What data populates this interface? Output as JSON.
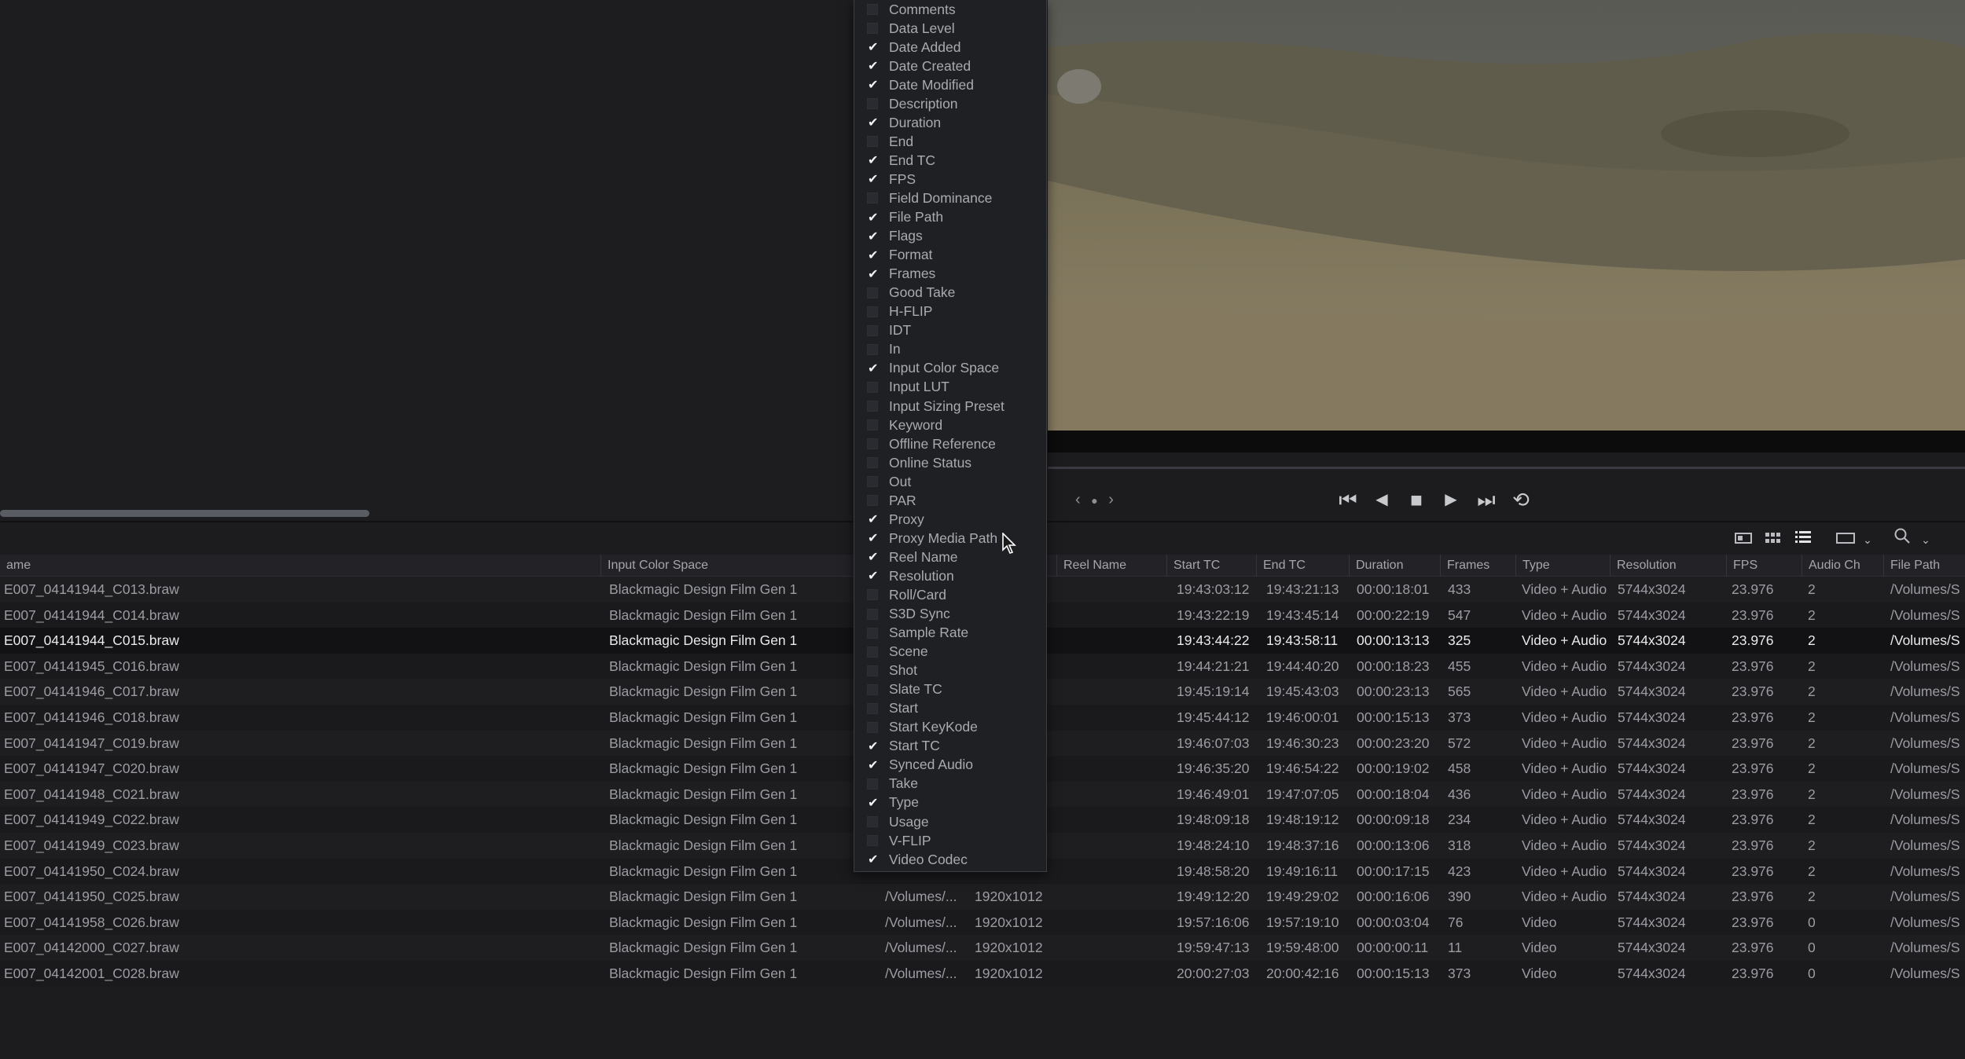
{
  "viewer": {
    "transport": {
      "prev_arrow": "‹",
      "next_arrow": "›",
      "dot": "●",
      "jump_start": "⏮",
      "step_back": "◀",
      "stop": "■",
      "play": "▶",
      "jump_end": "⏭",
      "loop": "⟲"
    }
  },
  "toolbar": {
    "icons": [
      "metadata-view-icon",
      "thumbnail-view-icon",
      "list-view-icon",
      "clip-display-icon",
      "chevron-down-icon",
      "search-icon",
      "chevron-down-icon"
    ]
  },
  "columns_menu": {
    "items": [
      {
        "label": "Comments",
        "checked": false
      },
      {
        "label": "Data Level",
        "checked": false
      },
      {
        "label": "Date Added",
        "checked": true
      },
      {
        "label": "Date Created",
        "checked": true
      },
      {
        "label": "Date Modified",
        "checked": true
      },
      {
        "label": "Description",
        "checked": false
      },
      {
        "label": "Duration",
        "checked": true
      },
      {
        "label": "End",
        "checked": false
      },
      {
        "label": "End TC",
        "checked": true
      },
      {
        "label": "FPS",
        "checked": true
      },
      {
        "label": "Field Dominance",
        "checked": false
      },
      {
        "label": "File Path",
        "checked": true
      },
      {
        "label": "Flags",
        "checked": true
      },
      {
        "label": "Format",
        "checked": true
      },
      {
        "label": "Frames",
        "checked": true
      },
      {
        "label": "Good Take",
        "checked": false
      },
      {
        "label": "H-FLIP",
        "checked": false
      },
      {
        "label": "IDT",
        "checked": false
      },
      {
        "label": "In",
        "checked": false
      },
      {
        "label": "Input Color Space",
        "checked": true
      },
      {
        "label": "Input LUT",
        "checked": false
      },
      {
        "label": "Input Sizing Preset",
        "checked": false
      },
      {
        "label": "Keyword",
        "checked": false
      },
      {
        "label": "Offline Reference",
        "checked": false
      },
      {
        "label": "Online Status",
        "checked": false
      },
      {
        "label": "Out",
        "checked": false
      },
      {
        "label": "PAR",
        "checked": false
      },
      {
        "label": "Proxy",
        "checked": true
      },
      {
        "label": "Proxy Media Path",
        "checked": true
      },
      {
        "label": "Reel Name",
        "checked": true
      },
      {
        "label": "Resolution",
        "checked": true
      },
      {
        "label": "Roll/Card",
        "checked": false
      },
      {
        "label": "S3D Sync",
        "checked": false
      },
      {
        "label": "Sample Rate",
        "checked": false
      },
      {
        "label": "Scene",
        "checked": false
      },
      {
        "label": "Shot",
        "checked": false
      },
      {
        "label": "Slate TC",
        "checked": false
      },
      {
        "label": "Start",
        "checked": false
      },
      {
        "label": "Start KeyKode",
        "checked": false
      },
      {
        "label": "Start TC",
        "checked": true
      },
      {
        "label": "Synced Audio",
        "checked": true
      },
      {
        "label": "Take",
        "checked": false
      },
      {
        "label": "Type",
        "checked": true
      },
      {
        "label": "Usage",
        "checked": false
      },
      {
        "label": "V-FLIP",
        "checked": false
      },
      {
        "label": "Video Codec",
        "checked": true
      }
    ]
  },
  "media_pool": {
    "headers": [
      "ame",
      "Input Color Space",
      "Reel Name",
      "Start TC",
      "End TC",
      "Duration",
      "Frames",
      "Type",
      "Resolution",
      "FPS",
      "Audio Ch",
      "File Path"
    ],
    "rows": [
      {
        "name": "E007_04141944_C013.braw",
        "color_space": "Blackmagic Design Film Gen 1",
        "proxy_path": "",
        "proxy_res": "",
        "start_tc": "19:43:03:12",
        "end_tc": "19:43:21:13",
        "duration": "00:00:18:01",
        "frames": "433",
        "type": "Video + Audio",
        "resolution": "5744x3024",
        "fps": "23.976",
        "audio_ch": "2",
        "file_path": "/Volumes/S"
      },
      {
        "name": "E007_04141944_C014.braw",
        "color_space": "Blackmagic Design Film Gen 1",
        "proxy_path": "",
        "proxy_res": "",
        "start_tc": "19:43:22:19",
        "end_tc": "19:43:45:14",
        "duration": "00:00:22:19",
        "frames": "547",
        "type": "Video + Audio",
        "resolution": "5744x3024",
        "fps": "23.976",
        "audio_ch": "2",
        "file_path": "/Volumes/S"
      },
      {
        "name": "E007_04141944_C015.braw",
        "color_space": "Blackmagic Design Film Gen 1",
        "proxy_path": "",
        "proxy_res": "",
        "start_tc": "19:43:44:22",
        "end_tc": "19:43:58:11",
        "duration": "00:00:13:13",
        "frames": "325",
        "type": "Video + Audio",
        "resolution": "5744x3024",
        "fps": "23.976",
        "audio_ch": "2",
        "file_path": "/Volumes/S",
        "selected": true
      },
      {
        "name": "E007_04141945_C016.braw",
        "color_space": "Blackmagic Design Film Gen 1",
        "proxy_path": "",
        "proxy_res": "",
        "start_tc": "19:44:21:21",
        "end_tc": "19:44:40:20",
        "duration": "00:00:18:23",
        "frames": "455",
        "type": "Video + Audio",
        "resolution": "5744x3024",
        "fps": "23.976",
        "audio_ch": "2",
        "file_path": "/Volumes/S"
      },
      {
        "name": "E007_04141946_C017.braw",
        "color_space": "Blackmagic Design Film Gen 1",
        "proxy_path": "",
        "proxy_res": "",
        "start_tc": "19:45:19:14",
        "end_tc": "19:45:43:03",
        "duration": "00:00:23:13",
        "frames": "565",
        "type": "Video + Audio",
        "resolution": "5744x3024",
        "fps": "23.976",
        "audio_ch": "2",
        "file_path": "/Volumes/S"
      },
      {
        "name": "E007_04141946_C018.braw",
        "color_space": "Blackmagic Design Film Gen 1",
        "proxy_path": "",
        "proxy_res": "",
        "start_tc": "19:45:44:12",
        "end_tc": "19:46:00:01",
        "duration": "00:00:15:13",
        "frames": "373",
        "type": "Video + Audio",
        "resolution": "5744x3024",
        "fps": "23.976",
        "audio_ch": "2",
        "file_path": "/Volumes/S"
      },
      {
        "name": "E007_04141947_C019.braw",
        "color_space": "Blackmagic Design Film Gen 1",
        "proxy_path": "",
        "proxy_res": "",
        "start_tc": "19:46:07:03",
        "end_tc": "19:46:30:23",
        "duration": "00:00:23:20",
        "frames": "572",
        "type": "Video + Audio",
        "resolution": "5744x3024",
        "fps": "23.976",
        "audio_ch": "2",
        "file_path": "/Volumes/S"
      },
      {
        "name": "E007_04141947_C020.braw",
        "color_space": "Blackmagic Design Film Gen 1",
        "proxy_path": "",
        "proxy_res": "",
        "start_tc": "19:46:35:20",
        "end_tc": "19:46:54:22",
        "duration": "00:00:19:02",
        "frames": "458",
        "type": "Video + Audio",
        "resolution": "5744x3024",
        "fps": "23.976",
        "audio_ch": "2",
        "file_path": "/Volumes/S"
      },
      {
        "name": "E007_04141948_C021.braw",
        "color_space": "Blackmagic Design Film Gen 1",
        "proxy_path": "",
        "proxy_res": "",
        "start_tc": "19:46:49:01",
        "end_tc": "19:47:07:05",
        "duration": "00:00:18:04",
        "frames": "436",
        "type": "Video + Audio",
        "resolution": "5744x3024",
        "fps": "23.976",
        "audio_ch": "2",
        "file_path": "/Volumes/S"
      },
      {
        "name": "E007_04141949_C022.braw",
        "color_space": "Blackmagic Design Film Gen 1",
        "proxy_path": "",
        "proxy_res": "",
        "start_tc": "19:48:09:18",
        "end_tc": "19:48:19:12",
        "duration": "00:00:09:18",
        "frames": "234",
        "type": "Video + Audio",
        "resolution": "5744x3024",
        "fps": "23.976",
        "audio_ch": "2",
        "file_path": "/Volumes/S"
      },
      {
        "name": "E007_04141949_C023.braw",
        "color_space": "Blackmagic Design Film Gen 1",
        "proxy_path": "",
        "proxy_res": "",
        "start_tc": "19:48:24:10",
        "end_tc": "19:48:37:16",
        "duration": "00:00:13:06",
        "frames": "318",
        "type": "Video + Audio",
        "resolution": "5744x3024",
        "fps": "23.976",
        "audio_ch": "2",
        "file_path": "/Volumes/S"
      },
      {
        "name": "E007_04141950_C024.braw",
        "color_space": "Blackmagic Design Film Gen 1",
        "proxy_path": "",
        "proxy_res": "",
        "start_tc": "19:48:58:20",
        "end_tc": "19:49:16:11",
        "duration": "00:00:17:15",
        "frames": "423",
        "type": "Video + Audio",
        "resolution": "5744x3024",
        "fps": "23.976",
        "audio_ch": "2",
        "file_path": "/Volumes/S"
      },
      {
        "name": "E007_04141950_C025.braw",
        "color_space": "Blackmagic Design Film Gen 1",
        "proxy_path": "/Volumes/...",
        "proxy_res": "1920x1012",
        "start_tc": "19:49:12:20",
        "end_tc": "19:49:29:02",
        "duration": "00:00:16:06",
        "frames": "390",
        "type": "Video + Audio",
        "resolution": "5744x3024",
        "fps": "23.976",
        "audio_ch": "2",
        "file_path": "/Volumes/S"
      },
      {
        "name": "E007_04141958_C026.braw",
        "color_space": "Blackmagic Design Film Gen 1",
        "proxy_path": "/Volumes/...",
        "proxy_res": "1920x1012",
        "start_tc": "19:57:16:06",
        "end_tc": "19:57:19:10",
        "duration": "00:00:03:04",
        "frames": "76",
        "type": "Video",
        "resolution": "5744x3024",
        "fps": "23.976",
        "audio_ch": "0",
        "file_path": "/Volumes/S"
      },
      {
        "name": "E007_04142000_C027.braw",
        "color_space": "Blackmagic Design Film Gen 1",
        "proxy_path": "/Volumes/...",
        "proxy_res": "1920x1012",
        "start_tc": "19:59:47:13",
        "end_tc": "19:59:48:00",
        "duration": "00:00:00:11",
        "frames": "11",
        "type": "Video",
        "resolution": "5744x3024",
        "fps": "23.976",
        "audio_ch": "0",
        "file_path": "/Volumes/S"
      },
      {
        "name": "E007_04142001_C028.braw",
        "color_space": "Blackmagic Design Film Gen 1",
        "proxy_path": "/Volumes/...",
        "proxy_res": "1920x1012",
        "start_tc": "20:00:27:03",
        "end_tc": "20:00:42:16",
        "duration": "00:00:15:13",
        "frames": "373",
        "type": "Video",
        "resolution": "5744x3024",
        "fps": "23.976",
        "audio_ch": "0",
        "file_path": "/Volumes/S"
      }
    ]
  },
  "colors": {
    "background": "#1c1c1f",
    "menu_bg": "#1f2024",
    "text_dim": "#9b9da3",
    "text_selected": "#eaeaec"
  }
}
